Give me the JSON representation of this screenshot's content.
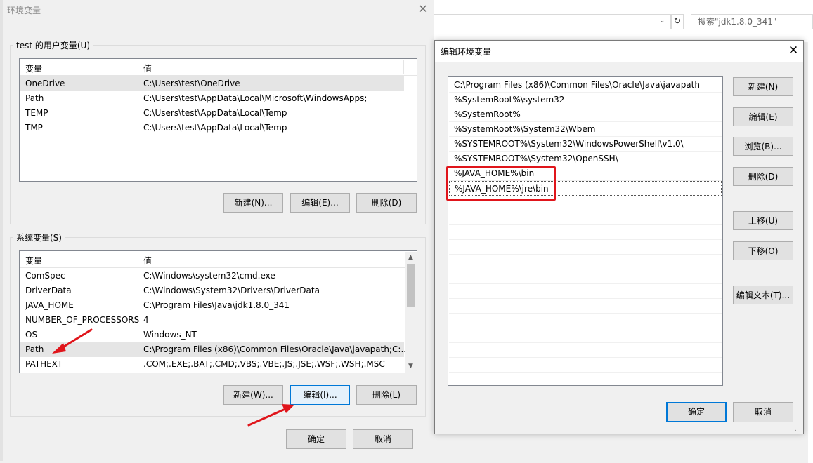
{
  "background": {
    "search_placeholder": "搜索\"jdk1.8.0_341\"",
    "refresh_icon": "↻",
    "chevron_icon": "⌄"
  },
  "left_dialog": {
    "title": "环境变量",
    "close_icon": "✕",
    "user_group": {
      "label": "test 的用户变量(U)",
      "col_variable": "变量",
      "col_value": "值",
      "rows": [
        {
          "name": "OneDrive",
          "value": "C:\\Users\\test\\OneDrive"
        },
        {
          "name": "Path",
          "value": "C:\\Users\\test\\AppData\\Local\\Microsoft\\WindowsApps;"
        },
        {
          "name": "TEMP",
          "value": "C:\\Users\\test\\AppData\\Local\\Temp"
        },
        {
          "name": "TMP",
          "value": "C:\\Users\\test\\AppData\\Local\\Temp"
        }
      ],
      "new_label": "新建(N)...",
      "edit_label": "编辑(E)...",
      "delete_label": "删除(D)"
    },
    "system_group": {
      "label": "系统变量(S)",
      "col_variable": "变量",
      "col_value": "值",
      "rows": [
        {
          "name": "ComSpec",
          "value": "C:\\Windows\\system32\\cmd.exe"
        },
        {
          "name": "DriverData",
          "value": "C:\\Windows\\System32\\Drivers\\DriverData"
        },
        {
          "name": "JAVA_HOME",
          "value": "C:\\Program Files\\Java\\jdk1.8.0_341"
        },
        {
          "name": "NUMBER_OF_PROCESSORS",
          "value": "4"
        },
        {
          "name": "OS",
          "value": "Windows_NT"
        },
        {
          "name": "Path",
          "value": "C:\\Program Files (x86)\\Common Files\\Oracle\\Java\\javapath;C:..."
        },
        {
          "name": "PATHEXT",
          "value": ".COM;.EXE;.BAT;.CMD;.VBS;.VBE;.JS;.JSE;.WSF;.WSH;.MSC"
        }
      ],
      "new_label": "新建(W)...",
      "edit_label": "编辑(I)...",
      "delete_label": "删除(L)"
    },
    "ok_label": "确定",
    "cancel_label": "取消"
  },
  "right_dialog": {
    "title": "编辑环境变量",
    "close_icon": "✕",
    "entries": [
      "C:\\Program Files (x86)\\Common Files\\Oracle\\Java\\javapath",
      "%SystemRoot%\\system32",
      "%SystemRoot%",
      "%SystemRoot%\\System32\\Wbem",
      "%SYSTEMROOT%\\System32\\WindowsPowerShell\\v1.0\\",
      "%SYSTEMROOT%\\System32\\OpenSSH\\",
      "%JAVA_HOME%\\bin",
      "%JAVA_HOME%\\jre\\bin"
    ],
    "buttons": {
      "new": "新建(N)",
      "edit": "编辑(E)",
      "browse": "浏览(B)...",
      "delete": "删除(D)",
      "move_up": "上移(U)",
      "move_down": "下移(O)",
      "edit_text": "编辑文本(T)..."
    },
    "ok_label": "确定",
    "cancel_label": "取消"
  },
  "annotation_color": "#e0151b"
}
